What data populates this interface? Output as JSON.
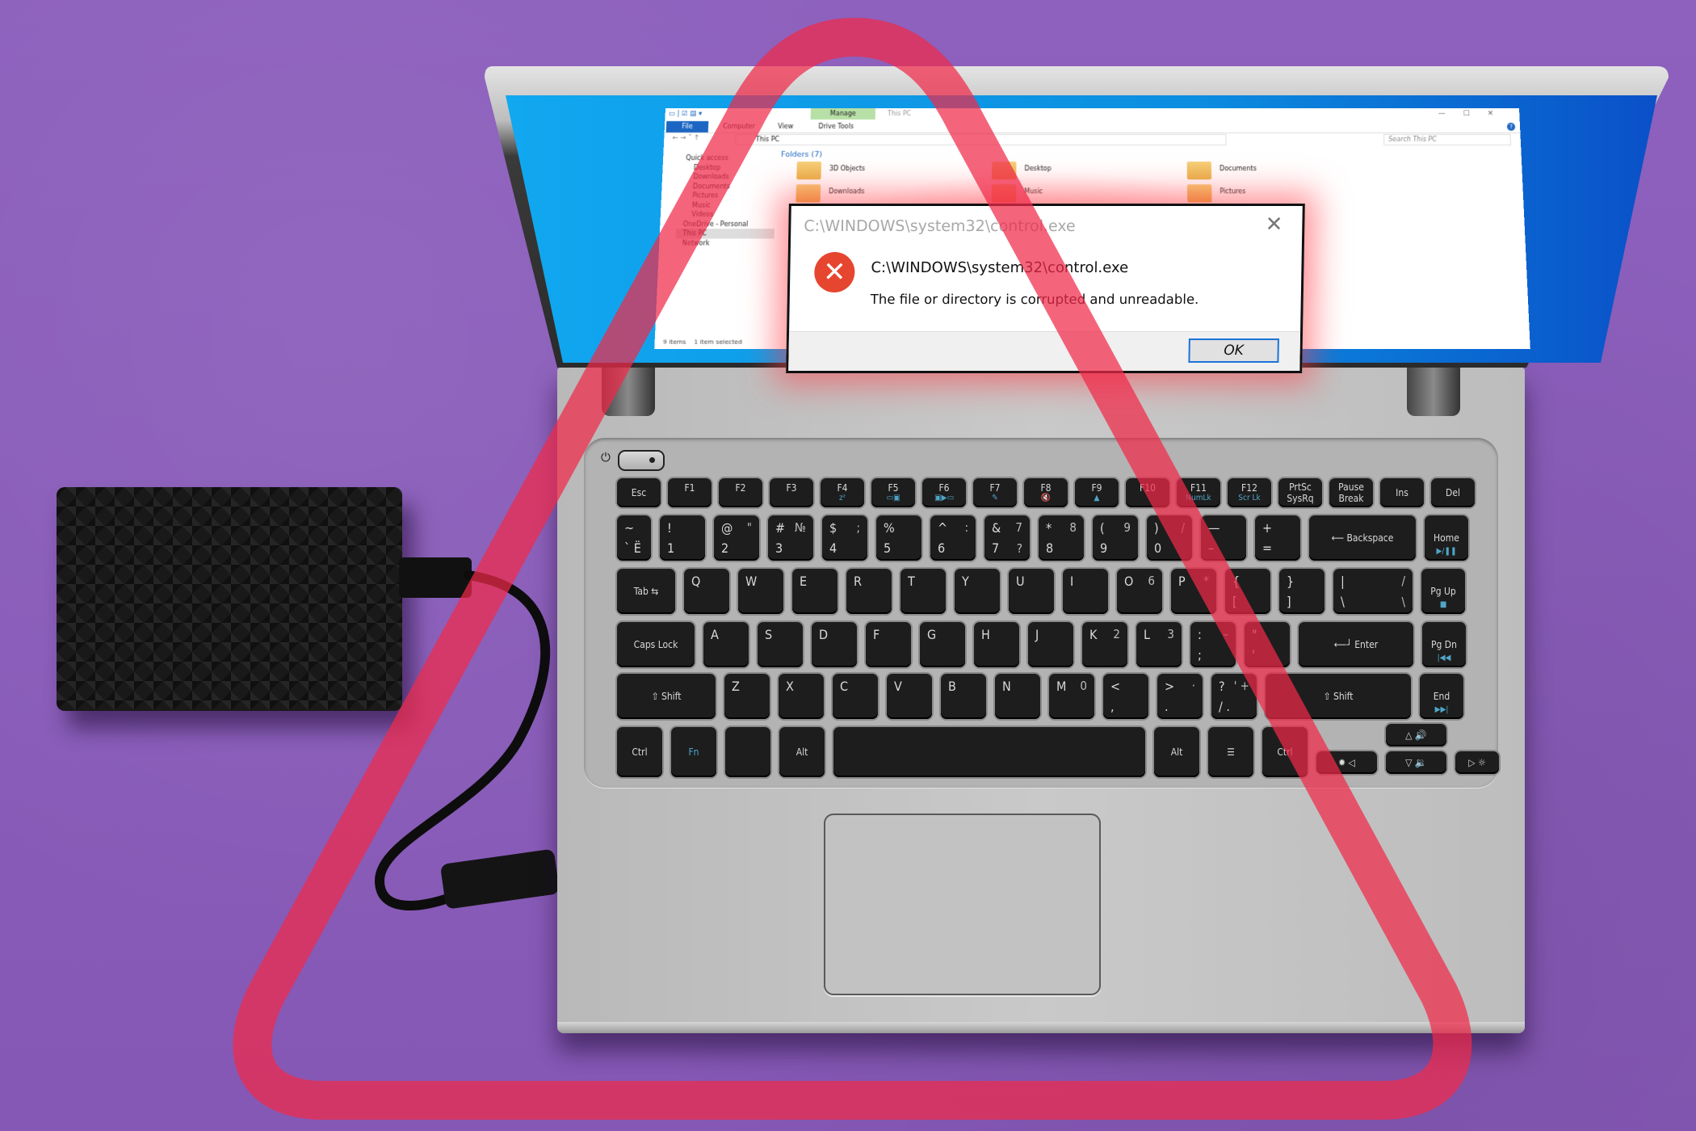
{
  "scene": {
    "description": "Laptop with external hard drive and corrupted file error",
    "colors": {
      "background": "#8a5cb8",
      "warning_triangle": "#f02a4a",
      "screen_blue": "#0a9fe8",
      "error_red": "#e64530",
      "accent_blue": "#1b66c3"
    }
  },
  "explorer": {
    "title": "This PC",
    "manage_tab": "Manage",
    "tabs": [
      "File",
      "Computer",
      "View",
      "Drive Tools"
    ],
    "window_buttons": [
      "—",
      "☐",
      "✕"
    ],
    "address": "This PC",
    "search_placeholder": "Search This PC",
    "nav": [
      "Quick access",
      "Desktop",
      "Downloads",
      "Documents",
      "Pictures",
      "Music",
      "Videos",
      "OneDrive - Personal",
      "This PC",
      "Network"
    ],
    "folders_header": "Folders (7)",
    "folders": [
      "3D Objects",
      "Desktop",
      "Documents",
      "Downloads",
      "Music",
      "Pictures"
    ],
    "status_items": "9 items",
    "status_selected": "1 item selected"
  },
  "dialog": {
    "title": "C:\\WINDOWS\\system32\\control.exe",
    "close_icon": "✕",
    "error_icon": "✕",
    "path": "C:\\WINDOWS\\system32\\control.exe",
    "message": "The file or directory is corrupted and unreadable.",
    "ok_label": "OK"
  },
  "keyboard": {
    "power_icon": "⏻",
    "row0": [
      {
        "m": "Esc"
      },
      {
        "fn": "F1"
      },
      {
        "fn": "F2"
      },
      {
        "fn": "F3"
      },
      {
        "fn": "F4",
        "fs": "zᶻ"
      },
      {
        "fn": "F5",
        "fs": "▭▣"
      },
      {
        "fn": "F6",
        "fs": "▣▶▭"
      },
      {
        "fn": "F7",
        "fs": "✎"
      },
      {
        "fn": "F8",
        "fs": "🔇"
      },
      {
        "fn": "F9",
        "fs": "▲"
      },
      {
        "fn": "F10"
      },
      {
        "fn": "F11",
        "fs": "NumLk"
      },
      {
        "fn": "F12",
        "fs": "Scr Lk"
      },
      {
        "m": "PrtSc\nSysRq"
      },
      {
        "m": "Pause\nBreak"
      },
      {
        "m": "Ins"
      },
      {
        "m": "Del"
      }
    ],
    "row1": [
      {
        "tl": "~",
        "bl": "` Ё"
      },
      {
        "tl": "!",
        "bl": "1"
      },
      {
        "tl": "@",
        "tr": "\"",
        "bl": "2"
      },
      {
        "tl": "#",
        "tr": "№",
        "bl": "3"
      },
      {
        "tl": "$",
        "tr": ";",
        "bl": "4"
      },
      {
        "tl": "%",
        "bl": "5"
      },
      {
        "tl": "^",
        "tr": ":",
        "bl": "6"
      },
      {
        "tl": "&",
        "tr": "7",
        "bl": "7",
        "br": "?"
      },
      {
        "tl": "*",
        "tr": "8",
        "bl": "8"
      },
      {
        "tl": "(",
        "tr": "9",
        "bl": "9"
      },
      {
        "tl": ")",
        "tr": "/",
        "bl": "0"
      },
      {
        "tl": "—",
        "bl": "–"
      },
      {
        "tl": "+",
        "bl": "="
      },
      {
        "m": "⟵ Backspace"
      },
      {
        "m": "Home",
        "fs": "▶/❚❚"
      }
    ],
    "row2": [
      {
        "m": "Tab ⇆"
      },
      {
        "tl": "Q"
      },
      {
        "tl": "W"
      },
      {
        "tl": "E"
      },
      {
        "tl": "R"
      },
      {
        "tl": "T"
      },
      {
        "tl": "Y"
      },
      {
        "tl": "U"
      },
      {
        "tl": "I"
      },
      {
        "tl": "O",
        "tr": "6"
      },
      {
        "tl": "P",
        "tr": "*"
      },
      {
        "tl": "{",
        "bl": "["
      },
      {
        "tl": "}",
        "bl": "]"
      },
      {
        "tl": "|",
        "tr": "/",
        "bl": "\\",
        "br": "\\"
      },
      {
        "m": "Pg Up",
        "fs": "■"
      }
    ],
    "row3": [
      {
        "m": "Caps Lock"
      },
      {
        "tl": "A"
      },
      {
        "tl": "S"
      },
      {
        "tl": "D"
      },
      {
        "tl": "F"
      },
      {
        "tl": "G"
      },
      {
        "tl": "H"
      },
      {
        "tl": "J"
      },
      {
        "tl": "K",
        "tr": "2"
      },
      {
        "tl": "L",
        "tr": "3"
      },
      {
        "tl": ":",
        "tr": "–",
        "bl": ";"
      },
      {
        "tl": "\"",
        "bl": "'"
      },
      {
        "m": "⟵┘ Enter"
      },
      {
        "m": "Pg Dn",
        "fs": "|◀◀"
      }
    ],
    "row4": [
      {
        "m": "⇧ Shift"
      },
      {
        "tl": "Z"
      },
      {
        "tl": "X"
      },
      {
        "tl": "C"
      },
      {
        "tl": "V"
      },
      {
        "tl": "B"
      },
      {
        "tl": "N"
      },
      {
        "tl": "M",
        "tr": "0"
      },
      {
        "tl": "<",
        "bl": ","
      },
      {
        "tl": ">",
        "tr": "·",
        "bl": "."
      },
      {
        "tl": "?",
        "tr": "' +",
        "bl": "/ ."
      },
      {
        "m": "⇧ Shift"
      },
      {
        "m": "End",
        "fs": "▶▶|"
      }
    ],
    "row5": [
      {
        "m": "Ctrl"
      },
      {
        "m": "Fn",
        "blue": true
      },
      {
        "m": ""
      },
      {
        "m": "Alt"
      },
      {
        "m": ""
      },
      {
        "m": "Alt"
      },
      {
        "m": "☰"
      },
      {
        "m": "Ctrl"
      },
      {
        "m": "✹ ◁"
      },
      {
        "m": "△ 🔊"
      },
      {
        "m": "▽ 🔉"
      },
      {
        "m": "▷ ☼"
      }
    ]
  }
}
